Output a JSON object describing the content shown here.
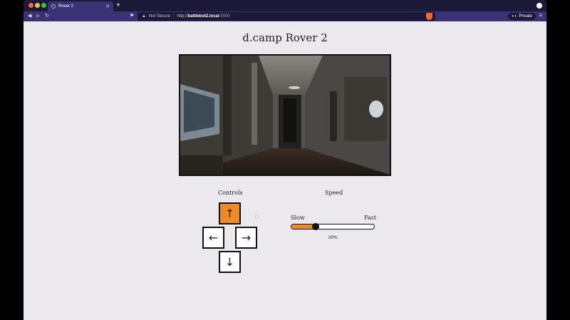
{
  "browser": {
    "tab_title": "Rover 2",
    "url_warning": "Not Secure",
    "url_scheme": "http://",
    "url_host": "battlebot2.local",
    "url_port": ":5000",
    "private_label": "Private"
  },
  "page": {
    "title": "d.camp Rover 2",
    "controls_label": "Controls",
    "speed_label": "Speed",
    "speed_slow": "Slow",
    "speed_fast": "Fast",
    "speed_value": "30%",
    "speed_fraction": 0.3
  },
  "controls": {
    "up": "↑",
    "left": "←",
    "right": "→",
    "down": "↓"
  },
  "colors": {
    "accent": "#f08a23",
    "background": "#ebe9ee",
    "browser_chrome": "#3a3275"
  },
  "icons": {
    "camera_feed": "rover-camera-feed"
  }
}
